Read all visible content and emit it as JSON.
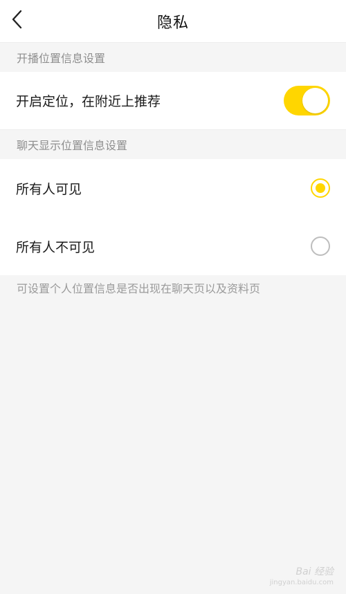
{
  "navbar": {
    "title": "隐私",
    "back_icon": "chevron-left-icon"
  },
  "sections": {
    "broadcast_header": "开播位置信息设置",
    "chat_header": "聊天显示位置信息设置"
  },
  "broadcast": {
    "toggle_label": "开启定位，在附近上推荐",
    "toggle_on": true
  },
  "chat_visibility": {
    "options": [
      {
        "label": "所有人可见",
        "selected": true
      },
      {
        "label": "所有人不可见",
        "selected": false
      }
    ]
  },
  "hint": "可设置个人位置信息是否出现在聊天页以及资料页",
  "watermark": {
    "logo": "Bai 经验",
    "url": "jingyan.baidu.com"
  },
  "colors": {
    "accent": "#ffd600",
    "background": "#f5f5f5",
    "secondary_text": "#8e8e8e"
  }
}
